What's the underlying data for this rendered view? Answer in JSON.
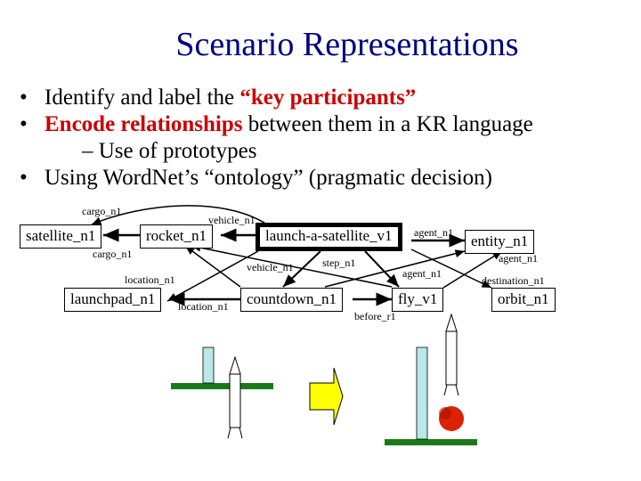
{
  "slide": {
    "title": "Scenario Representations",
    "bullets": [
      {
        "prefix": "Identify and label the ",
        "highlight": "“key participants”",
        "suffix": ""
      },
      {
        "prefix": "",
        "highlight": "Encode relationships",
        "suffix": " between them in a KR language"
      },
      {
        "sub": "– Use of prototypes"
      },
      {
        "prefix": "Using WordNet’s “ontology” (pragmatic decision)",
        "highlight": "",
        "suffix": ""
      }
    ],
    "bullet_glyph": "•",
    "highlight_color": "#cc0000",
    "title_color": "#000080"
  },
  "diagram": {
    "nodes": {
      "satellite": "satellite_n1",
      "rocket": "rocket_n1",
      "launch": "launch-a-satellite_v1",
      "entity": "entity_n1",
      "launchpad": "launchpad_n1",
      "countdown": "countdown_n1",
      "fly": "fly_v1",
      "orbit": "orbit_n1"
    },
    "edge_labels": {
      "cargo_top": "cargo_n1",
      "cargo_bottom": "cargo_n1",
      "vehicle_top": "vehicle_n1",
      "vehicle_mid": "vehicle_n1",
      "location_top": "location_n1",
      "location_bottom": "location_n1",
      "step": "step_n1",
      "agent_top": "agent_n1",
      "agent_right": "agent_n1",
      "agent_mid": "agent_n1",
      "destination": "destination_n1",
      "before": "before_r1"
    }
  },
  "illustration": {
    "ground_color": "#1a7a1a",
    "arrow_color": "#ffff00",
    "tower_color": "#b8e8e8",
    "explosion_color": "#dd2200"
  }
}
